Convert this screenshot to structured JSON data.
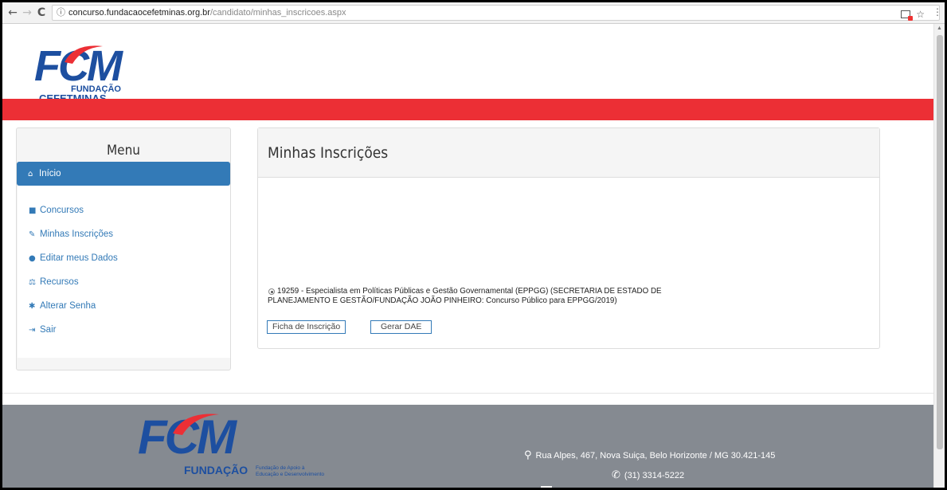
{
  "browser": {
    "back_icon": "←",
    "forward_icon": "→",
    "reload_icon": "C",
    "info_icon": "ⓘ",
    "url_host": "concurso.fundacaocefetminas.org.br",
    "url_path": "/candidato/minhas_inscricoes.aspx",
    "star_icon": "☆",
    "menu_icon": "⋮"
  },
  "logo": {
    "fcm": "FCM",
    "fundacao": "FUNDAÇÃO",
    "cefetminas": "CEFETMINAS"
  },
  "sidebar": {
    "title": "Menu",
    "items": [
      {
        "icon": "⌂",
        "label": "Início"
      },
      {
        "icon": "■",
        "label": "Concursos"
      },
      {
        "icon": "✎",
        "label": "Minhas Inscrições"
      },
      {
        "icon": "●",
        "label": "Editar meus Dados"
      },
      {
        "icon": "⚖",
        "label": "Recursos"
      },
      {
        "icon": "✱",
        "label": "Alterar Senha"
      },
      {
        "icon": "⇥",
        "label": "Sair"
      }
    ]
  },
  "main": {
    "title": "Minhas Inscrições",
    "inscricao": "19259 - Especialista em Políticas Públicas e Gestão Governamental (EPPGG) (SECRETARIA DE ESTADO DE PLANEJAMENTO E GESTÃO/FUNDAÇÃO JOÃO PINHEIRO: Concurso Público para EPPGG/2019)",
    "btn_ficha": "Ficha de Inscrição",
    "btn_dae": "Gerar DAE"
  },
  "footer": {
    "fcm": "FCM",
    "fundacao": "FUNDAÇÃO",
    "sub": "Fundação de Apoio à Educação e Desenvolvimento",
    "address_icon": "⚲",
    "address": "Rua Alpes, 467, Nova Suiça, Belo Horizonte / MG 30.421-145",
    "phone_icon": "✆",
    "phone": "(31) 3314-5222"
  },
  "colors": {
    "brand_blue": "#1d4fa0",
    "red_bar": "#ec2f35",
    "link_blue": "#337ab7",
    "footer_gray": "#858a91"
  }
}
